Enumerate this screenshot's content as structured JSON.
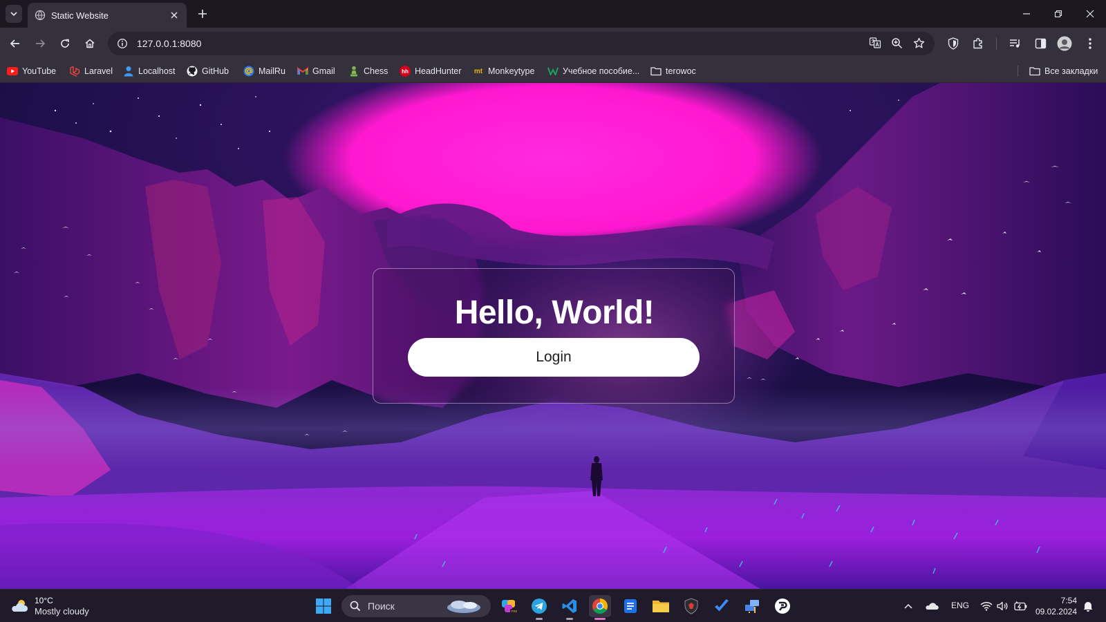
{
  "browser": {
    "tab": {
      "title": "Static Website"
    },
    "address": {
      "url": "127.0.0.1:8080"
    },
    "bookmarks": [
      {
        "label": "YouTube",
        "icon": "youtube-icon"
      },
      {
        "label": "Laravel",
        "icon": "laravel-icon"
      },
      {
        "label": "Localhost",
        "icon": "person-icon"
      },
      {
        "label": "GitHub",
        "icon": "github-icon"
      },
      {
        "label": "MailRu",
        "icon": "mailru-icon"
      },
      {
        "label": "Gmail",
        "icon": "gmail-icon"
      },
      {
        "label": "Chess",
        "icon": "chess-pawn-icon"
      },
      {
        "label": "HeadHunter",
        "icon": "headhunter-icon"
      },
      {
        "label": "Monkeytype",
        "icon": "monkeytype-icon"
      },
      {
        "label": "Учебное пособие...",
        "icon": "w-icon"
      },
      {
        "label": "terowoc",
        "icon": "folder-icon"
      }
    ],
    "all_bookmarks": "Все закладки"
  },
  "page": {
    "title": "Hello, World!",
    "login_button": "Login"
  },
  "taskbar": {
    "weather": {
      "temp": "10°C",
      "condition": "Mostly cloudy"
    },
    "search_placeholder": "Поиск",
    "lang": "ENG",
    "time": "7:54",
    "date": "09.02.2024"
  },
  "colors": {
    "accent_pink": "#ff1fd0",
    "browser_bg": "#35313c",
    "tabstrip_bg": "#1b1821",
    "taskbar_bg": "#1f1b2a"
  }
}
